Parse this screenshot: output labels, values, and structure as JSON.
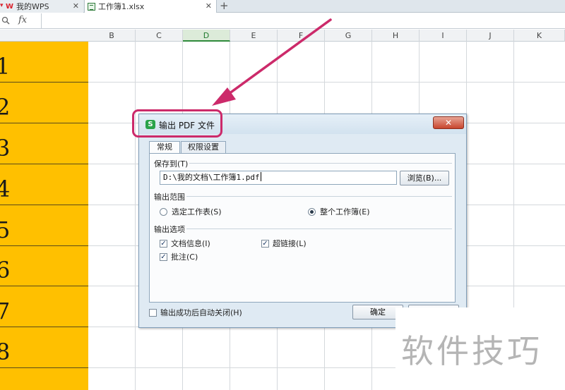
{
  "tabs": [
    {
      "label": "我的WPS",
      "close": "✕"
    },
    {
      "label": "工作簿1.xlsx",
      "close": "✕"
    }
  ],
  "tab_add": "+",
  "formula_bar": {
    "fx": "fx"
  },
  "columns": [
    "B",
    "C",
    "D",
    "E",
    "F",
    "G",
    "H",
    "I",
    "J",
    "K"
  ],
  "selected_column": "D",
  "row_numbers": [
    "1",
    "2",
    "3",
    "4",
    "5",
    "6",
    "7",
    "8"
  ],
  "colors": {
    "row_fill": "#ffc000",
    "annotation": "#cc2a6a",
    "selected_col": "#2f8b3c"
  },
  "dialog": {
    "icon": "S",
    "title": "输出 PDF 文件",
    "close": "✕",
    "tabs": [
      "常规",
      "权限设置"
    ],
    "save_to_label": "保存到(T)",
    "path_value": "D:\\我的文档\\工作簿1.pdf",
    "browse_label": "浏览(B)...",
    "range_label": "输出范围",
    "range_options": [
      {
        "label": "选定工作表(S)",
        "selected": false
      },
      {
        "label": "整个工作簿(E)",
        "selected": true
      }
    ],
    "output_options_label": "输出选项",
    "checkboxes": [
      {
        "label": "文档信息(I)",
        "checked": true
      },
      {
        "label": "超链接(L)",
        "checked": true
      },
      {
        "label": "批注(C)",
        "checked": true
      }
    ],
    "auto_close_label": "输出成功后自动关闭(H)",
    "auto_close_checked": false,
    "ok_label": "确定"
  },
  "watermark": "软件技巧"
}
